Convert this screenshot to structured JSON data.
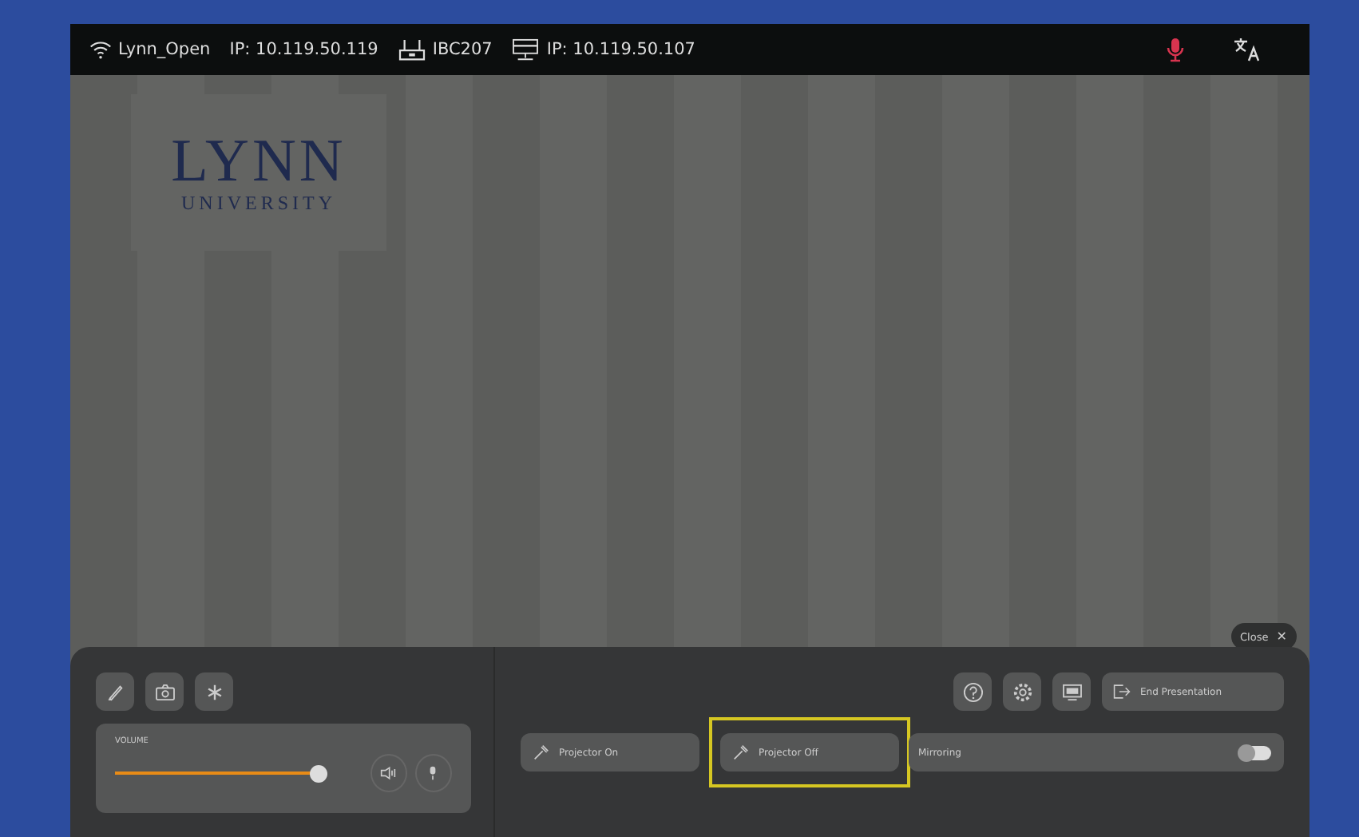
{
  "top_bar": {
    "network": "Lynn_Open",
    "network_ip": "IP: 10.119.50.119",
    "room": "IBC207",
    "device_ip": "IP: 10.119.50.107",
    "mic_muted": true
  },
  "logo": {
    "name": "LYNN",
    "subtitle": "UNIVERSITY"
  },
  "close_button": {
    "label": "Close",
    "icon": "✕"
  },
  "volume": {
    "label": "VOLUME",
    "level": 0.97
  },
  "controls": {
    "end_presentation": "End Presentation",
    "projector_buttons": [
      {
        "label": "Projector On",
        "highlighted": false
      },
      {
        "label": "Projector Off",
        "highlighted": true
      }
    ],
    "mirroring": {
      "label": "Mirroring",
      "on": false
    }
  }
}
